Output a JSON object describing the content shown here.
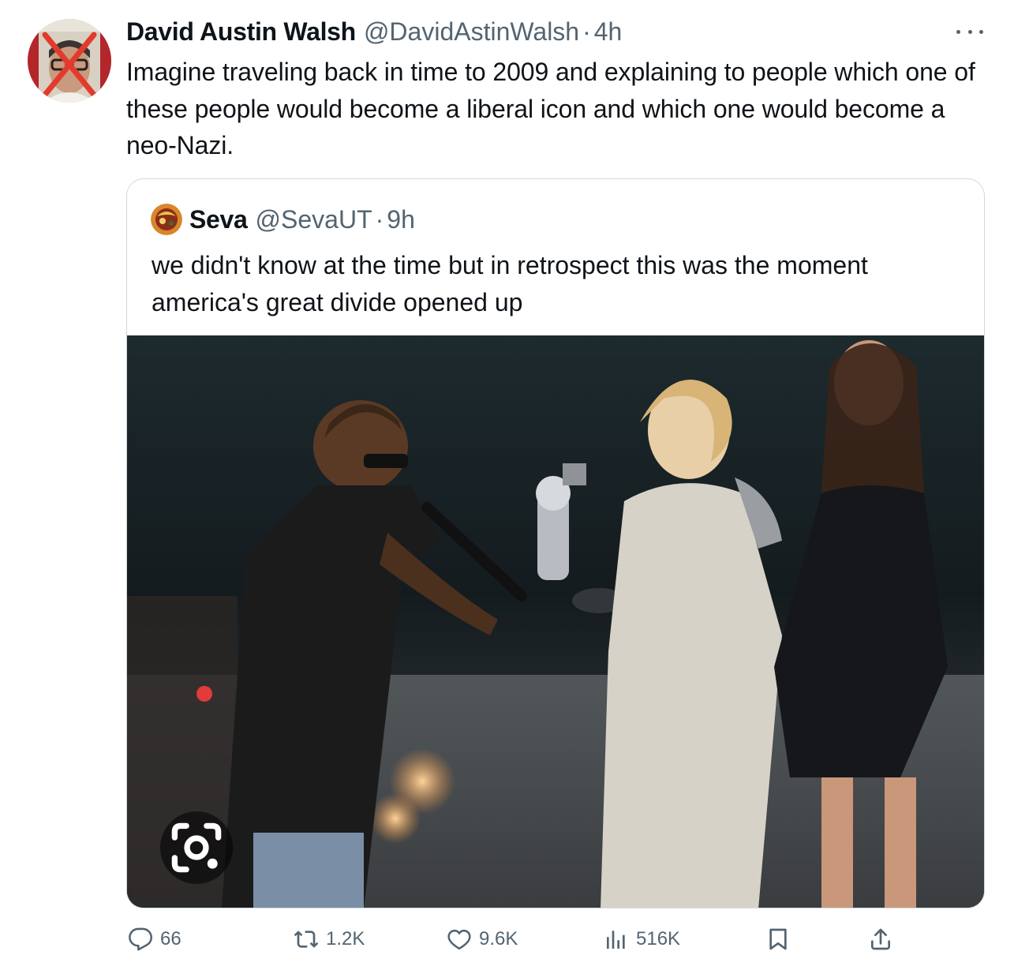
{
  "tweet": {
    "author": {
      "display_name": "David Austin Walsh",
      "handle": "@DavidAstinWalsh",
      "separator": "·",
      "time": "4h",
      "avatar_icon": "portrait-with-red-x-icon"
    },
    "text": "Imagine traveling back in time to 2009 and explaining to people which one of these people would become a liberal icon and which one would become a neo-Nazi.",
    "more_icon": "more-dots-icon"
  },
  "quoted_tweet": {
    "author": {
      "display_name": "Seva",
      "handle": "@SevaUT",
      "separator": "·",
      "time": "9h"
    },
    "text": "we didn't know at the time but in retrospect this was the moment america's great divide opened up",
    "media": {
      "icon": "photo",
      "lens_icon": "lens-camera-icon"
    }
  },
  "actions": {
    "replies": "66",
    "reposts": "1.2K",
    "likes": "9.6K",
    "views": "516K"
  },
  "colors": {
    "text_primary": "#0f1419",
    "text_secondary": "#536471",
    "border": "#cfd9de"
  }
}
